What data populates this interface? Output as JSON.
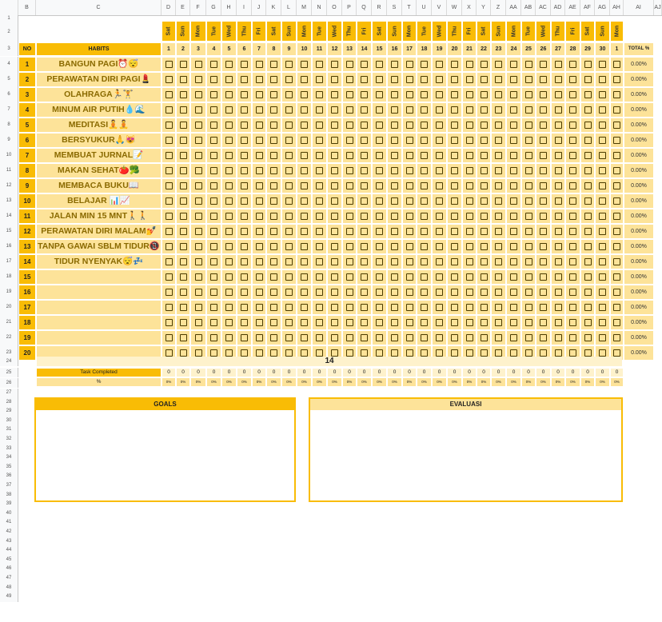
{
  "column_headers": [
    "",
    "B",
    "C",
    "D",
    "E",
    "F",
    "G",
    "H",
    "I",
    "J",
    "K",
    "L",
    "M",
    "N",
    "O",
    "P",
    "Q",
    "R",
    "S",
    "T",
    "U",
    "V",
    "W",
    "X",
    "Y",
    "Z",
    "AA",
    "AB",
    "AC",
    "AD",
    "AE",
    "AF",
    "AG",
    "AH",
    "AI",
    "AJ"
  ],
  "days_of_week": [
    "Sat",
    "Sun",
    "Mon",
    "Tue",
    "Wed",
    "Thu",
    "Fri",
    "Sat",
    "Sun",
    "Mon",
    "Tue",
    "Wed",
    "Thu",
    "Fri",
    "Sat",
    "Sun",
    "Mon",
    "Tue",
    "Wed",
    "Thu",
    "Fri",
    "Sat",
    "Sun",
    "Mon",
    "Tue",
    "Wed",
    "Thu",
    "Fri",
    "Sat",
    "Sun",
    "Mon"
  ],
  "day_numbers": [
    "1",
    "2",
    "3",
    "4",
    "5",
    "6",
    "7",
    "8",
    "9",
    "10",
    "11",
    "12",
    "13",
    "14",
    "15",
    "16",
    "17",
    "18",
    "19",
    "20",
    "21",
    "22",
    "23",
    "24",
    "25",
    "26",
    "27",
    "28",
    "29",
    "30",
    "1"
  ],
  "header": {
    "no": "NO",
    "habits": "HABITS",
    "total": "TOTAL %"
  },
  "habits": [
    {
      "no": "1",
      "name": "BANGUN PAGI⏰😴",
      "total": "0.00%"
    },
    {
      "no": "2",
      "name": "PERAWATAN DIRI PAGI💄",
      "total": "0.00%"
    },
    {
      "no": "3",
      "name": "OLAHRAGA🏃🏋",
      "total": "0.00%"
    },
    {
      "no": "4",
      "name": "MINUM AIR PUTIH💧🌊",
      "total": "0.00%"
    },
    {
      "no": "5",
      "name": "MEDITASI🧘🧘",
      "total": "0.00%"
    },
    {
      "no": "6",
      "name": "BERSYUKUR🙏😻",
      "total": "0.00%"
    },
    {
      "no": "7",
      "name": "MEMBUAT JURNAL📝",
      "total": "0.00%"
    },
    {
      "no": "8",
      "name": "MAKAN SEHAT🍅🥦",
      "total": "0.00%"
    },
    {
      "no": "9",
      "name": "MEMBACA BUKU📖",
      "total": "0.00%"
    },
    {
      "no": "10",
      "name": "BELAJAR 📊📈",
      "total": "0.00%"
    },
    {
      "no": "11",
      "name": "JALAN MIN 15 MNT🚶🚶",
      "total": "0.00%"
    },
    {
      "no": "12",
      "name": "PERAWATAN DIRI MALAM💅",
      "total": "0.00%"
    },
    {
      "no": "13",
      "name": "TANPA GAWAI SBLM TIDUR📵",
      "total": "0.00%"
    },
    {
      "no": "14",
      "name": "TIDUR NYENYAK😴💤",
      "total": "0.00%"
    },
    {
      "no": "15",
      "name": "",
      "total": "0.00%"
    },
    {
      "no": "16",
      "name": "",
      "total": "0.00%"
    },
    {
      "no": "17",
      "name": "",
      "total": "0.00%"
    },
    {
      "no": "18",
      "name": "",
      "total": "0.00%"
    },
    {
      "no": "19",
      "name": "",
      "total": "0.00%"
    },
    {
      "no": "20",
      "name": "",
      "total": "0.00%"
    }
  ],
  "habit_count": "14",
  "task_completed": {
    "label": "Task Completed",
    "value": "0"
  },
  "percent_row": {
    "label": "%",
    "value": "0%"
  },
  "panels": {
    "goals": "GOALS",
    "evaluasi": "EVALUASI"
  },
  "colors": {
    "accent": "#f9bc05",
    "light": "#fde399",
    "pale": "#fef2cc"
  }
}
